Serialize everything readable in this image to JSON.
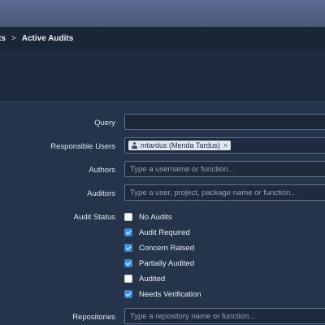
{
  "breadcrumb": {
    "parent": "ts",
    "separator": ">",
    "current": "Active Audits"
  },
  "form": {
    "query": {
      "label": "Query",
      "value": ""
    },
    "responsible_users": {
      "label": "Responsible Users",
      "tags": [
        {
          "text": "mtardus (Menda Tardus)",
          "remove": "×"
        }
      ]
    },
    "authors": {
      "label": "Authors",
      "placeholder": "Type a username or function..."
    },
    "auditors": {
      "label": "Auditors",
      "placeholder": "Type a user, project, package name or function..."
    },
    "audit_status": {
      "label": "Audit Status",
      "options": [
        {
          "label": "No Audits",
          "checked": false
        },
        {
          "label": "Audit Required",
          "checked": true
        },
        {
          "label": "Concern Raised",
          "checked": true
        },
        {
          "label": "Partially Audited",
          "checked": true
        },
        {
          "label": "Audited",
          "checked": false
        },
        {
          "label": "Needs Verification",
          "checked": true
        }
      ]
    },
    "repositories": {
      "label": "Repositories",
      "placeholder": "Type a repository name or function..."
    }
  },
  "colors": {
    "accent": "#3e8fe6",
    "background": "#26344a",
    "breadcrumb_bar": "#1a2536",
    "top_bar": "#4a5a7c"
  }
}
